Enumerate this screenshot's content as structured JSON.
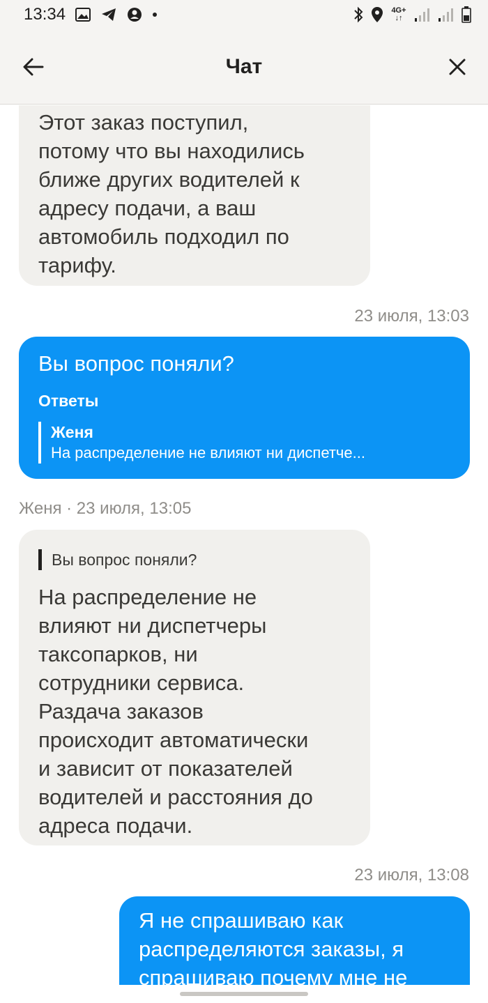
{
  "status_bar": {
    "time": "13:34",
    "network": "4G+"
  },
  "header": {
    "title": "Чат"
  },
  "messages": [
    {
      "lines": [
        "Этот заказ поступил,",
        "потому что вы находились",
        "ближе других водителей к",
        "адресу подачи, а ваш",
        "автомобиль подходил по",
        "тарифу."
      ]
    },
    {
      "timestamp": "23 июля, 13:03",
      "text": "Вы вопрос поняли?",
      "reply_label": "Ответы",
      "quote_author": "Женя",
      "quote_text": "На распределение не влияют ни диспетче..."
    },
    {
      "meta": "Женя · 23 июля, 13:05",
      "quote_text": "Вы вопрос поняли?",
      "lines": [
        "На распределение не",
        "влияют ни диспетчеры",
        "таксопарков, ни",
        "сотрудники сервиса.",
        "Раздача заказов",
        "происходит автоматически",
        "и зависит от показателей",
        "водителей и расстояния до",
        "адреса подачи."
      ]
    },
    {
      "timestamp": "23 июля, 13:08",
      "lines": [
        "Я не спрашиваю как",
        "распределяются заказы, я",
        "спрашиваю почему мне не"
      ]
    }
  ]
}
